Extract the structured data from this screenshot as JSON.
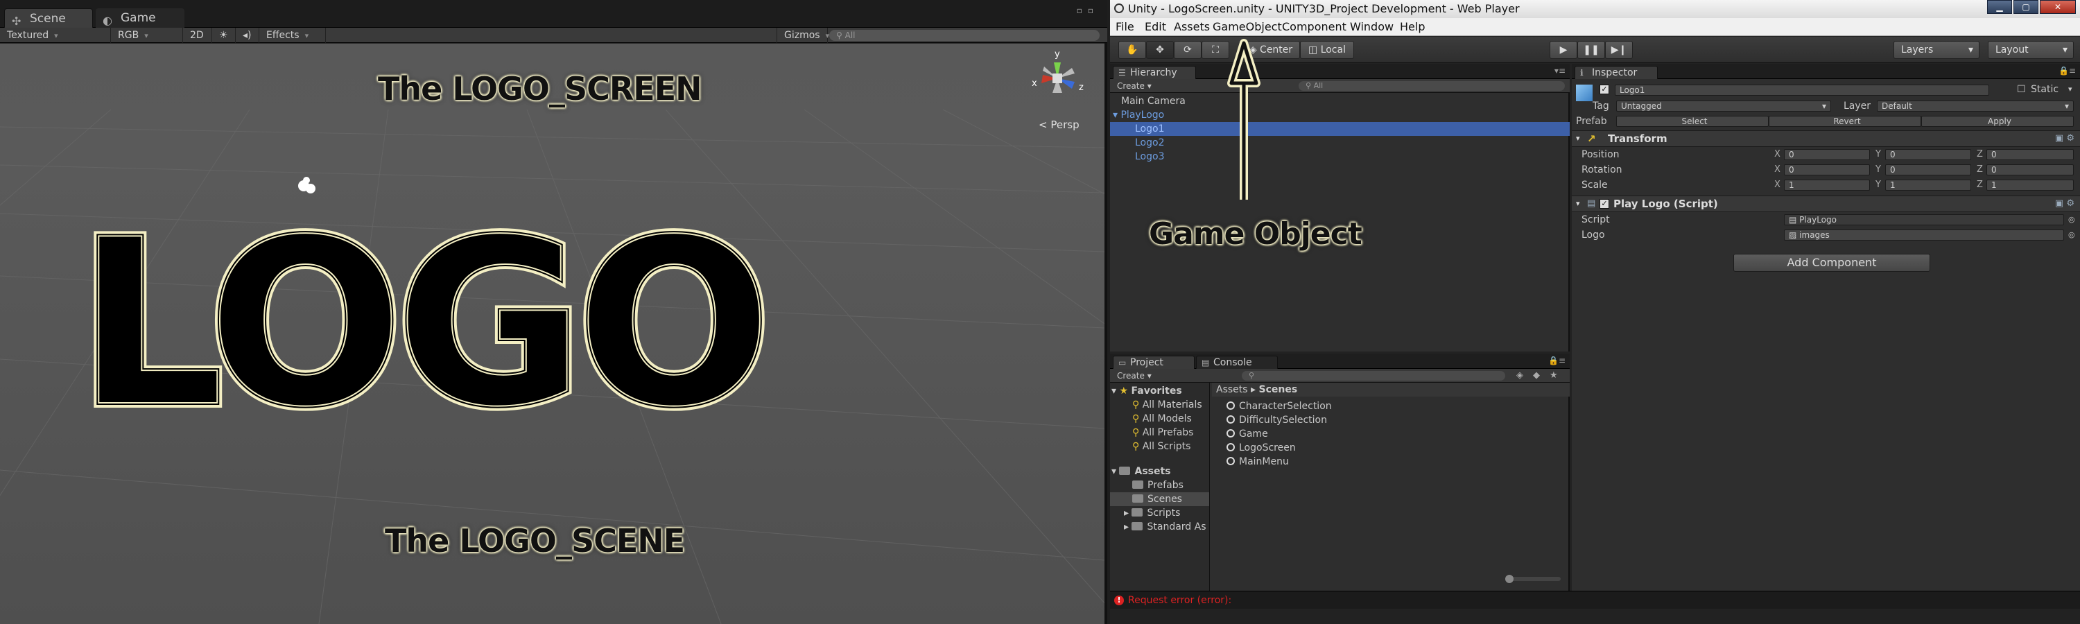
{
  "scene_window": {
    "tabs": [
      {
        "label": "Scene",
        "icon": "scene-icon"
      },
      {
        "label": "Game",
        "icon": "game-icon"
      }
    ],
    "toolbar": {
      "shading": "Textured",
      "render_mode": "RGB",
      "mode_2d": "2D",
      "effects": "Effects",
      "gizmos": "Gizmos",
      "search_placeholder": "All"
    },
    "logo_text": "LOGO",
    "caption_top": "The LOGO_SCREEN",
    "caption_bottom": "The LOGO_SCENE",
    "gizmo": {
      "x": "x",
      "y": "y",
      "z": "z"
    },
    "persp": "Persp"
  },
  "title_bar": {
    "title": "Unity - LogoScreen.unity - UNITY3D_Project Development - Web Player"
  },
  "menu": [
    "File",
    "Edit",
    "Assets",
    "GameObject",
    "Component",
    "Window",
    "Help"
  ],
  "toolbar": {
    "pivot": "Center",
    "space": "Local",
    "layers": "Layers",
    "layout": "Layout"
  },
  "hierarchy": {
    "tab": "Hierarchy",
    "create": "Create",
    "search_placeholder": "All",
    "items": [
      {
        "label": "Main Camera"
      },
      {
        "label": "PlayLogo"
      },
      {
        "label": "Logo1"
      },
      {
        "label": "Logo2"
      },
      {
        "label": "Logo3"
      }
    ]
  },
  "inspector": {
    "tab": "Inspector",
    "object_name": "Logo1",
    "static_label": "Static",
    "tag_label": "Tag",
    "tag_value": "Untagged",
    "layer_label": "Layer",
    "layer_value": "Default",
    "prefab_label": "Prefab",
    "prefab_select": "Select",
    "prefab_revert": "Revert",
    "prefab_apply": "Apply",
    "transform": {
      "title": "Transform",
      "position_label": "Position",
      "rotation_label": "Rotation",
      "scale_label": "Scale",
      "position": {
        "x": "0",
        "y": "0",
        "z": "0"
      },
      "rotation": {
        "x": "0",
        "y": "0",
        "z": "0"
      },
      "scale": {
        "x": "1",
        "y": "1",
        "z": "1"
      },
      "axis_x": "X",
      "axis_y": "Y",
      "axis_z": "Z"
    },
    "script_component": {
      "title": "Play Logo (Script)",
      "script_label": "Script",
      "script_value": "PlayLogo",
      "logo_label": "Logo",
      "logo_value": "images"
    },
    "add_component": "Add Component"
  },
  "project": {
    "tab_project": "Project",
    "tab_console": "Console",
    "create": "Create",
    "favorites_label": "Favorites",
    "favorites": [
      "All Materials",
      "All Models",
      "All Prefabs",
      "All Scripts"
    ],
    "assets_label": "Assets",
    "folders": [
      "Prefabs",
      "Scenes",
      "Scripts",
      "Standard As"
    ],
    "breadcrumb_root": "Assets",
    "breadcrumb_sep": "▸",
    "breadcrumb_current": "Scenes",
    "scenes": [
      "CharacterSelection",
      "DifficultySelection",
      "Game",
      "LogoScreen",
      "MainMenu"
    ]
  },
  "status_bar": {
    "message": "Request error (error):"
  },
  "annotation": {
    "label": "Game Object"
  }
}
